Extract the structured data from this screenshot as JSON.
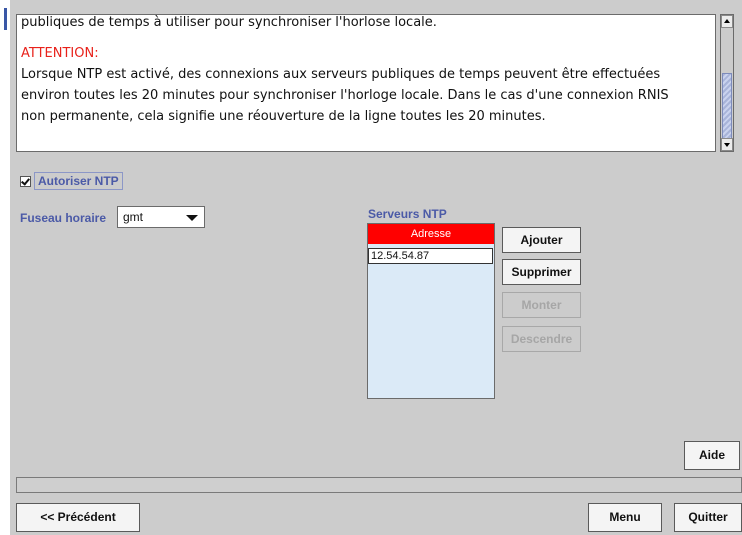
{
  "info_text": {
    "lines": [
      "publiques de temps à utiliser pour synchroniser l'horlose locale.",
      "ATTENTION:",
      "Lorsque NTP est activé, des connexions aux serveurs publiques de temps peuvent être effectuées",
      "environ toutes les 20 minutes pour synchroniser l'horloge locale. Dans le cas d'une connexion RNIS",
      "non permanente, cela signifie une réouverture de la ligne toutes les 20 minutes."
    ],
    "warning_color": "#e8221b"
  },
  "ntp": {
    "enable_label": "Autoriser NTP",
    "enabled": true
  },
  "timezone": {
    "label": "Fuseau horaire",
    "selected": "gmt"
  },
  "servers": {
    "title": "Serveurs NTP",
    "column_header": "Adresse",
    "header_color": "#ff0000",
    "rows": [
      "12.54.54.87"
    ]
  },
  "buttons": {
    "add": "Ajouter",
    "remove": "Supprimer",
    "up": "Monter",
    "down": "Descendre",
    "help": "Aide",
    "previous": "<< Précédent",
    "menu": "Menu",
    "quit": "Quitter"
  },
  "colors": {
    "label_blue": "#4b5aa7",
    "panel_gray": "#cccccc",
    "list_bg": "#dbeaf7"
  }
}
